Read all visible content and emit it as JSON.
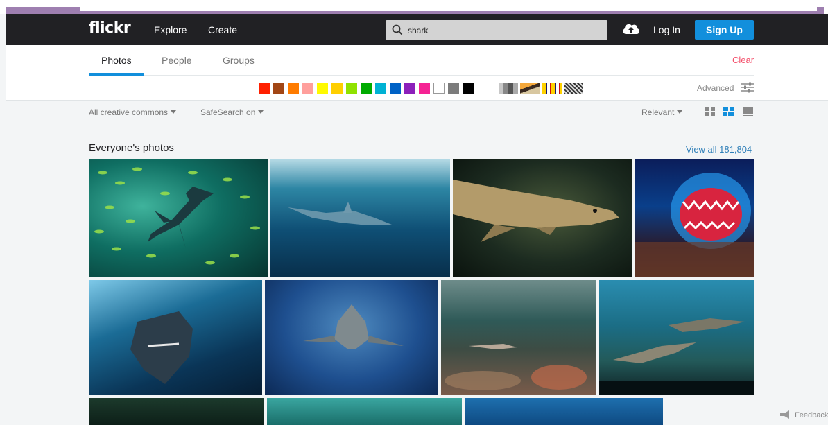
{
  "header": {
    "logo": "flickr",
    "nav": [
      "Explore",
      "Create"
    ],
    "search_value": "shark",
    "login": "Log In",
    "signup": "Sign Up"
  },
  "tabs": [
    "Photos",
    "People",
    "Groups"
  ],
  "clear": "Clear",
  "colors": [
    "#ff2000",
    "#a24615",
    "#ff7c00",
    "#ff9f9c",
    "#fffa00",
    "#ffcf00",
    "#90e200",
    "#00ab00",
    "#00b2d4",
    "#0062c6",
    "#8c20ba",
    "#f52394",
    "#ffffff",
    "#7c7c7c",
    "#000000"
  ],
  "advanced": "Advanced",
  "filters": {
    "license": "All creative commons",
    "safesearch": "SafeSearch on",
    "sort": "Relevant"
  },
  "section": {
    "title": "Everyone's photos",
    "view_all": "View all 181,804"
  },
  "feedback": "Feedback"
}
